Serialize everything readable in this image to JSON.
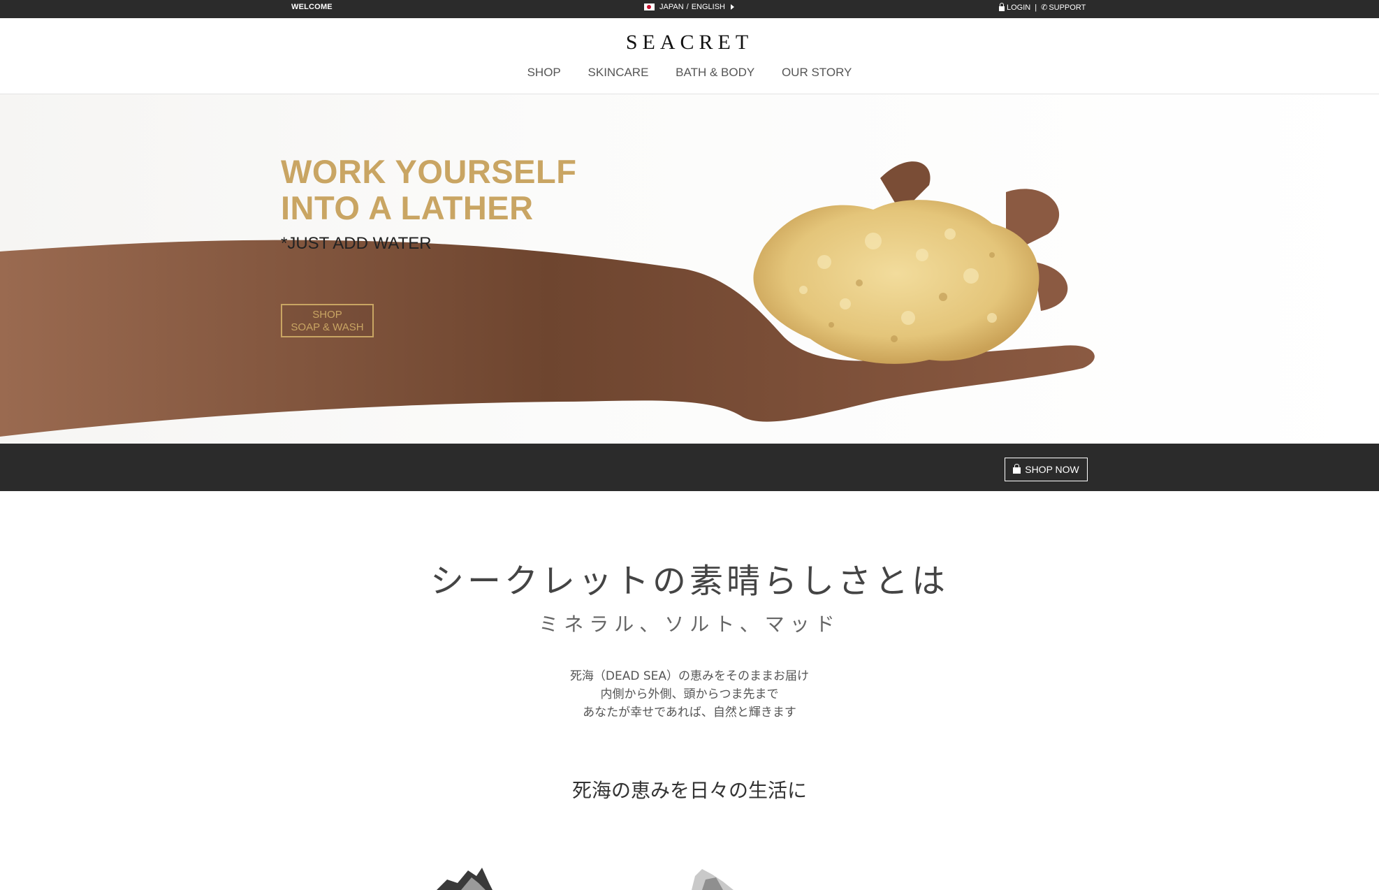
{
  "topbar": {
    "welcome": "WELCOME",
    "country": "JAPAN",
    "separator": "/",
    "language": "ENGLISH",
    "login": "LOGIN",
    "divider": "|",
    "support": "SUPPORT"
  },
  "header": {
    "logo": "SEACRET",
    "nav": [
      "SHOP",
      "SKINCARE",
      "BATH & BODY",
      "OUR STORY"
    ]
  },
  "hero": {
    "title_line1": "WORK YOURSELF",
    "title_line2": "INTO A LATHER",
    "subtitle": "*JUST ADD WATER",
    "button_line1": "SHOP",
    "button_line2": "SOAP & WASH"
  },
  "shopbar": {
    "label": "SHOP NOW"
  },
  "intro": {
    "title": "シークレットの素晴らしさとは",
    "subtitle": "ミネラル、ソルト、マッド",
    "lines": [
      "死海（DEAD SEA）の恵みをそのままお届け",
      "内側から外側、頭からつま先まで",
      "あなたが幸せであれば、自然と輝きます"
    ],
    "section_title": "死海の恵みを日々の生活に"
  },
  "colors": {
    "gold": "#c9a563",
    "dark": "#2b2b2b"
  }
}
